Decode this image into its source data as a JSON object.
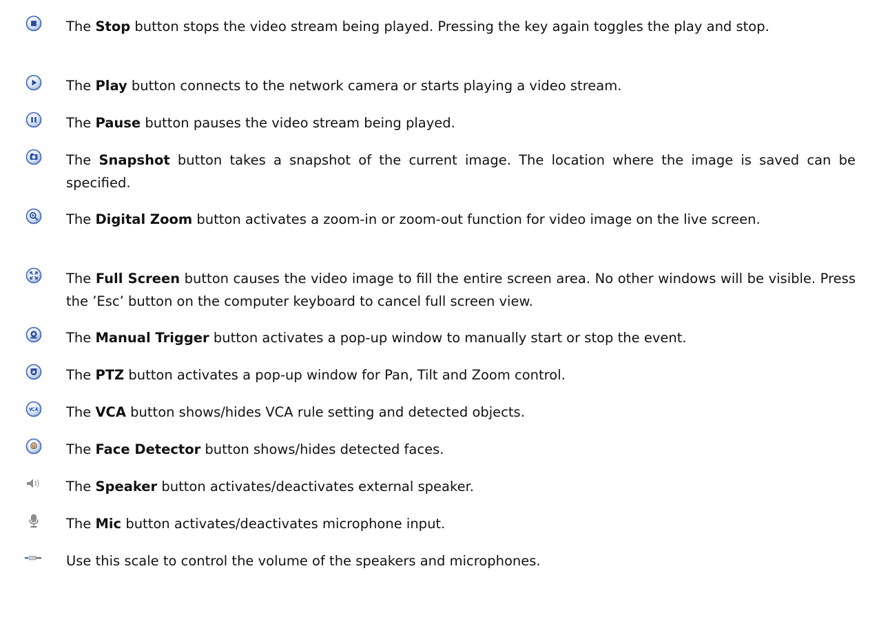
{
  "entries": [
    {
      "icon": "stop-button-icon",
      "prefix": "The ",
      "name": "Stop",
      "rest": " button stops the video stream being played. Pressing the key again toggles the play and stop."
    },
    {
      "icon": "play-button-icon",
      "prefix": "The ",
      "name": "Play",
      "rest": " button connects to the network camera or starts playing a video stream."
    },
    {
      "icon": "pause-button-icon",
      "prefix": "The ",
      "name": "Pause",
      "rest": " button pauses the video stream being played."
    },
    {
      "icon": "snapshot-button-icon",
      "prefix": "The ",
      "name": "Snapshot",
      "rest": " button takes a snapshot of the current image. The location where the image is saved can be specified."
    },
    {
      "icon": "digital-zoom-button-icon",
      "prefix": "The ",
      "name": "Digital Zoom",
      "rest": " button activates a zoom-in or zoom-out function for video image on the live screen."
    },
    {
      "icon": "full-screen-button-icon",
      "prefix": "The ",
      "name": "Full Screen",
      "rest": " button causes the video image to fill the entire screen area. No other windows will be visible. Press the ’Esc’ button on the computer keyboard to cancel full screen view."
    },
    {
      "icon": "manual-trigger-button-icon",
      "prefix": "The ",
      "name": "Manual Trigger",
      "rest": " button activates a pop-up window to manually start or stop the event."
    },
    {
      "icon": "ptz-button-icon",
      "prefix": "The ",
      "name": "PTZ",
      "rest": " button activates a pop-up window for Pan, Tilt and Zoom control."
    },
    {
      "icon": "vca-button-icon",
      "prefix": "The ",
      "name": "VCA",
      "rest": " button shows/hides VCA rule setting and detected objects."
    },
    {
      "icon": "face-detector-button-icon",
      "prefix": "The ",
      "name": "Face Detector",
      "rest": " button shows/hides detected faces."
    },
    {
      "icon": "speaker-icon",
      "prefix": "The ",
      "name": "Speaker",
      "rest": " button activates/deactivates external speaker."
    },
    {
      "icon": "microphone-icon",
      "prefix": "The ",
      "name": "Mic",
      "rest": " button activates/deactivates microphone input."
    },
    {
      "icon": "volume-scale-icon",
      "prefix": "",
      "name": "",
      "rest": "Use this scale to control the volume of the speakers and microphones."
    }
  ],
  "icon_colors": {
    "ring_light": "#e8eefa",
    "ring_dark": "#3f68b8",
    "glyph": "#2a4f9e",
    "vca_text": "#2d5ab0",
    "face_skin": "#d9b78e",
    "gray_icon": "#8a8a8a"
  }
}
